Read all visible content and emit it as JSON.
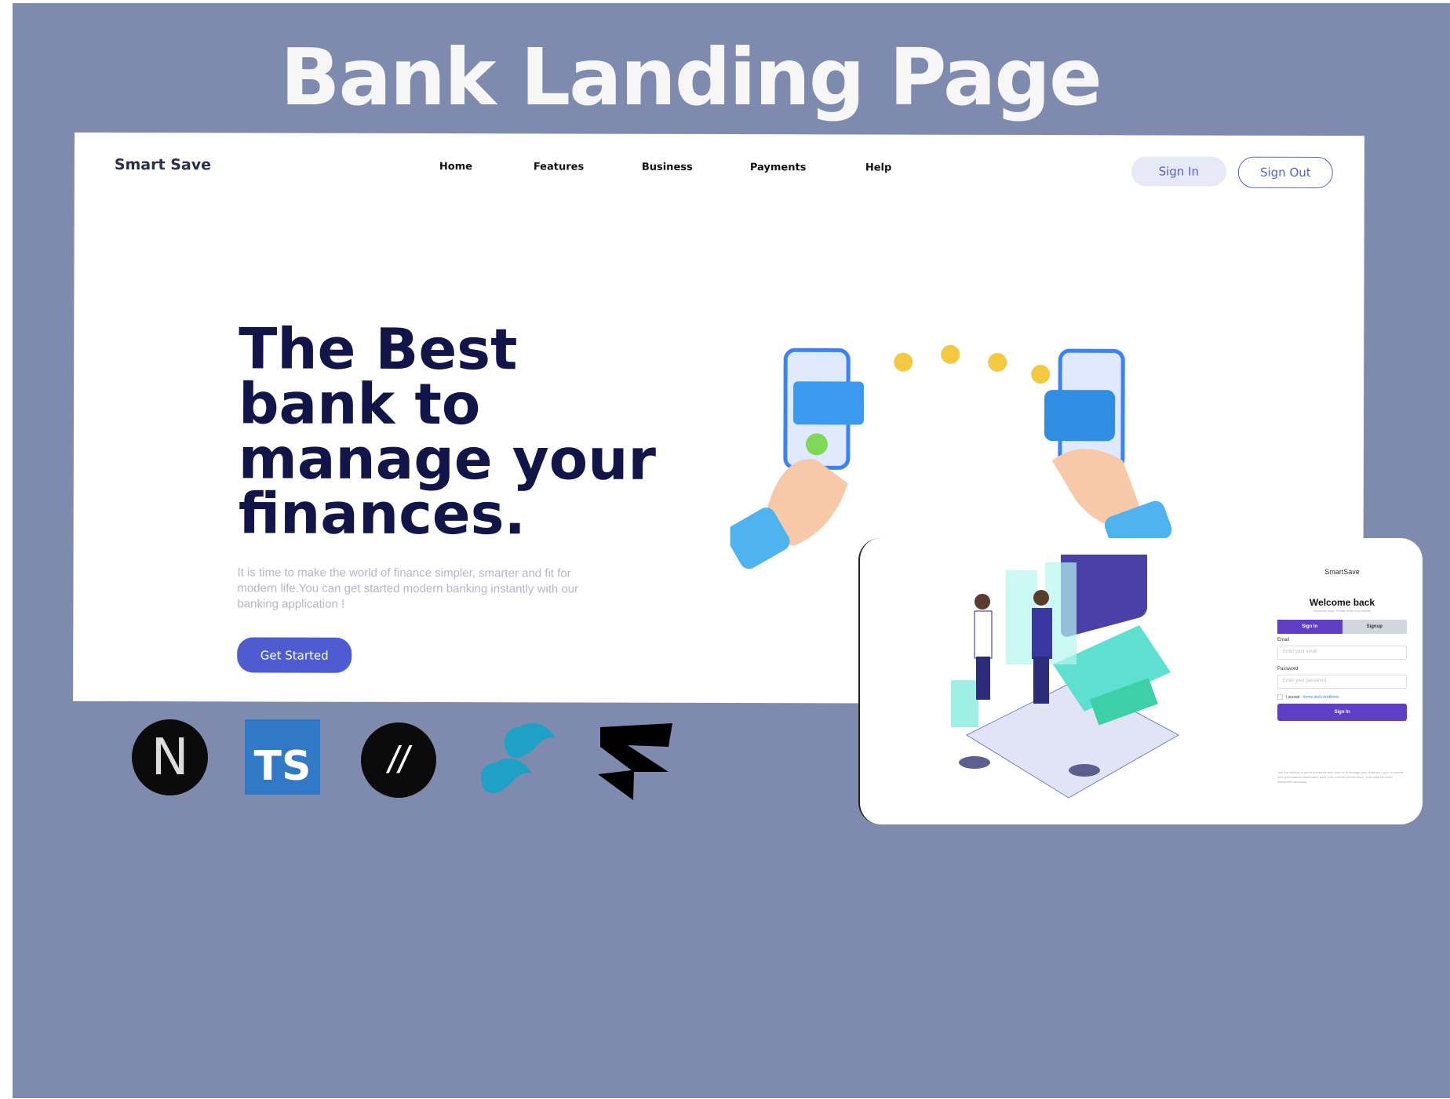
{
  "title": "Bank Landing Page",
  "site": {
    "logo": "Smart Save",
    "nav": [
      "Home",
      "Features",
      "Business",
      "Payments",
      "Help"
    ],
    "sign_in": "Sign In",
    "sign_out": "Sign Out",
    "hero_lines": [
      "The Best",
      "bank to",
      "manage your",
      "finances."
    ],
    "paragraph": "It is time to make the world of finance simpler, smarter and fit for modern life.You can get started modern banking instantly with our banking application !",
    "cta": "Get Started"
  },
  "login": {
    "brand": "SmartSave",
    "heading": "Welcome back",
    "subheading": "Welcome back. Please enter Your details",
    "tab_signin": "Sign In",
    "tab_signup": "Signup",
    "email_label": "Email",
    "email_placeholder": "Enter your email",
    "password_label": "Password",
    "password_placeholder": "Enter your password",
    "accept": "I accept",
    "terms": "terms and conditions",
    "submit": "Sign In",
    "footer": "Join the millions of smart investions who trust us to manage their finances.Log in to access your personalized dashboard, track your portfolio performance, and make informed investment decisions."
  },
  "tech": {
    "ts": "TS",
    "next": "N",
    "slash": "//"
  },
  "colors": {
    "background": "#7f8aaf",
    "accent": "#4f5bd0",
    "login_accent": "#5f3dc4",
    "heading": "#121548"
  }
}
